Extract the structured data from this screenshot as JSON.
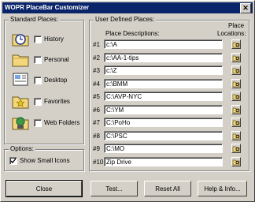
{
  "window": {
    "title": "WOPR PlaceBar Customizer"
  },
  "standard": {
    "group_label": "Standard Places:",
    "items": [
      {
        "label": "History",
        "icon": "history-folder-icon",
        "checked": false
      },
      {
        "label": "Personal",
        "icon": "personal-folder-icon",
        "checked": false
      },
      {
        "label": "Desktop",
        "icon": "desktop-icon",
        "checked": false
      },
      {
        "label": "Favorites",
        "icon": "favorites-folder-icon",
        "checked": false
      },
      {
        "label": "Web Folders",
        "icon": "web-folders-icon",
        "checked": false
      }
    ]
  },
  "options": {
    "group_label": "Options:",
    "show_small_icons_label": "Show Small Icons",
    "show_small_icons_checked": true
  },
  "user_defined": {
    "group_label": "User Defined Places:",
    "desc_header": "Place Descriptions:",
    "loc_header_line1": "Place",
    "loc_header_line2": "Locations:",
    "rows": [
      {
        "num": "#1",
        "desc": "c:\\A"
      },
      {
        "num": "#2",
        "desc": "c:\\AA-1-tips"
      },
      {
        "num": "#3",
        "desc": "c:\\Z"
      },
      {
        "num": "#4",
        "desc": "c:\\BMM"
      },
      {
        "num": "#5",
        "desc": "C:\\AVP-NYC"
      },
      {
        "num": "#6",
        "desc": "C:\\YM"
      },
      {
        "num": "#7",
        "desc": "C:\\PoHo"
      },
      {
        "num": "#8",
        "desc": "C:\\PSC"
      },
      {
        "num": "#9",
        "desc": "C:\\MO"
      },
      {
        "num": "#10",
        "desc": "Zip Drive"
      }
    ]
  },
  "buttons": {
    "close": "Close",
    "test": "Test...",
    "reset_all": "Reset All",
    "help_info": "Help & Info..."
  }
}
